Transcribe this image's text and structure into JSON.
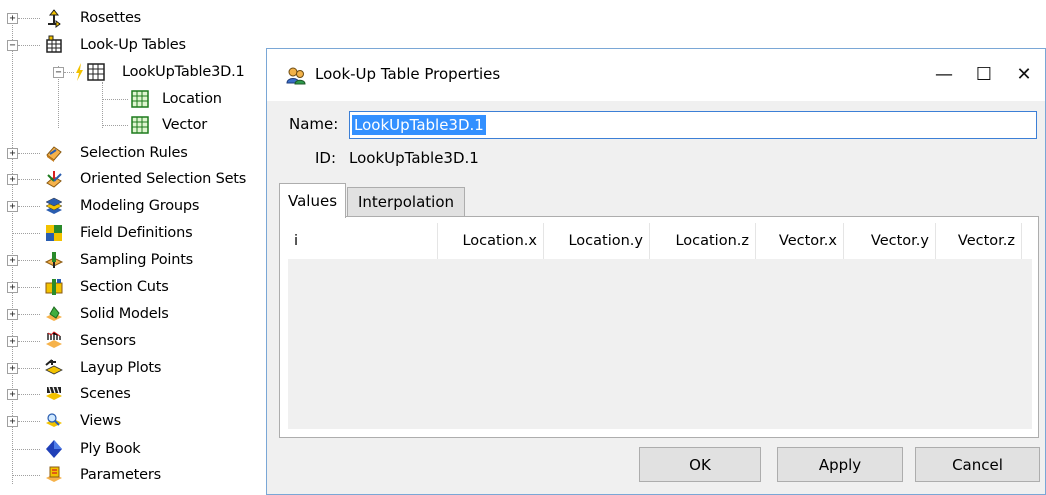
{
  "tree": {
    "items": [
      {
        "label": "Rosettes",
        "icon": "rosette-icon",
        "expander": "+"
      },
      {
        "label": "Look-Up Tables",
        "icon": "lookup-tables-icon",
        "expander": "−"
      },
      {
        "label": "LookUpTable3D.1",
        "icon": "table-icon",
        "expander": "−"
      },
      {
        "label": "Location",
        "icon": "table-icon",
        "expander": ""
      },
      {
        "label": "Vector",
        "icon": "table-icon",
        "expander": ""
      },
      {
        "label": "Selection Rules",
        "icon": "selection-rules-icon",
        "expander": "+"
      },
      {
        "label": "Oriented Selection Sets",
        "icon": "oriented-selection-sets-icon",
        "expander": "+"
      },
      {
        "label": "Modeling Groups",
        "icon": "modeling-groups-icon",
        "expander": "+"
      },
      {
        "label": "Field Definitions",
        "icon": "field-definitions-icon",
        "expander": ""
      },
      {
        "label": "Sampling Points",
        "icon": "sampling-points-icon",
        "expander": "+"
      },
      {
        "label": "Section Cuts",
        "icon": "section-cuts-icon",
        "expander": "+"
      },
      {
        "label": "Solid Models",
        "icon": "solid-models-icon",
        "expander": "+"
      },
      {
        "label": "Sensors",
        "icon": "sensors-icon",
        "expander": "+"
      },
      {
        "label": "Layup Plots",
        "icon": "layup-plots-icon",
        "expander": "+"
      },
      {
        "label": "Scenes",
        "icon": "scenes-icon",
        "expander": "+"
      },
      {
        "label": "Views",
        "icon": "views-icon",
        "expander": "+"
      },
      {
        "label": "Ply Book",
        "icon": "ply-book-icon",
        "expander": ""
      },
      {
        "label": "Parameters",
        "icon": "parameters-icon",
        "expander": ""
      }
    ]
  },
  "dialog": {
    "title": "Look-Up Table Properties",
    "name_label": "Name:",
    "name_value": "LookUpTable3D.1",
    "id_label": "ID:",
    "id_value": "LookUpTable3D.1",
    "tabs": [
      "Values",
      "Interpolation"
    ],
    "columns": [
      "i",
      "Location.x",
      "Location.y",
      "Location.z",
      "Vector.x",
      "Vector.y",
      "Vector.z"
    ],
    "buttons": {
      "ok": "OK",
      "apply": "Apply",
      "cancel": "Cancel"
    },
    "window_controls": {
      "minimize": "—",
      "maximize": "☐",
      "close": "✕"
    }
  },
  "colors": {
    "selection": "#3390ff",
    "input_focus_border": "#3c7fd6",
    "dialog_bg": "#f0f0f0",
    "button_bg": "#e1e1e1"
  }
}
